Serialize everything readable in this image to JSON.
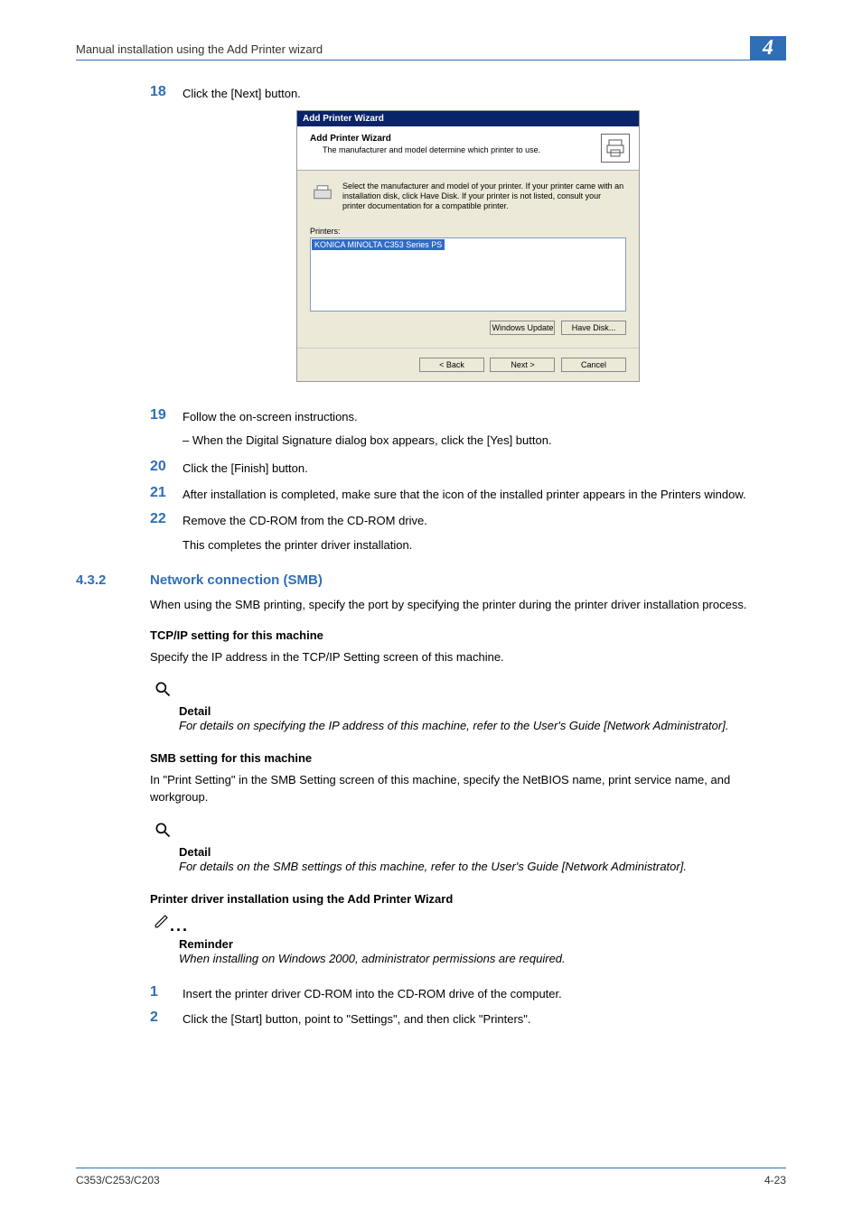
{
  "header": {
    "title": "Manual installation using the Add Printer wizard",
    "chapter": "4"
  },
  "wizard": {
    "titlebar": "Add Printer Wizard",
    "head_title": "Add Printer Wizard",
    "head_sub": "The manufacturer and model determine which printer to use.",
    "instruction": "Select the manufacturer and model of your printer. If your printer came with an installation disk, click Have Disk. If your printer is not listed, consult your printer documentation for a compatible printer.",
    "list_label": "Printers:",
    "list_item": "KONICA MINOLTA C353 Series PS",
    "btn_win_update": "Windows Update",
    "btn_have_disk": "Have Disk...",
    "btn_back": "< Back",
    "btn_next": "Next >",
    "btn_cancel": "Cancel"
  },
  "steps": {
    "s18_num": "18",
    "s18": "Click the [Next] button.",
    "s19_num": "19",
    "s19": "Follow the on-screen instructions.",
    "s19_sub": "When the Digital Signature dialog box appears, click the [Yes] button.",
    "s20_num": "20",
    "s20": "Click the [Finish] button.",
    "s21_num": "21",
    "s21": "After installation is completed, make sure that the icon of the installed printer appears in the Printers window.",
    "s22_num": "22",
    "s22": "Remove the CD-ROM from the CD-ROM drive.",
    "completion": "This completes the printer driver installation."
  },
  "section": {
    "num": "4.3.2",
    "title": "Network connection (SMB)",
    "intro": "When using the SMB printing, specify the port by specifying the printer during the printer driver installation process."
  },
  "tcpip": {
    "head": "TCP/IP setting for this machine",
    "text": "Specify the IP address in the TCP/IP Setting screen of this machine.",
    "detail_label": "Detail",
    "detail_text": "For details on specifying the IP address of this machine, refer to the User's Guide [Network Administrator]."
  },
  "smb": {
    "head": "SMB setting for this machine",
    "text": "In \"Print Setting\" in the SMB Setting screen of this machine, specify the NetBIOS name, print service name, and workgroup.",
    "detail_label": "Detail",
    "detail_text": "For details on the SMB settings of this machine, refer to the User's Guide [Network Administrator]."
  },
  "driver": {
    "head": "Printer driver installation using the Add Printer Wizard",
    "reminder_label": "Reminder",
    "reminder_text": "When installing on Windows 2000, administrator permissions are required.",
    "s1_num": "1",
    "s1": "Insert the printer driver CD-ROM into the CD-ROM drive of the computer.",
    "s2_num": "2",
    "s2": "Click the [Start] button, point to \"Settings\", and then click \"Printers\"."
  },
  "footer": {
    "left": "C353/C253/C203",
    "right": "4-23"
  }
}
